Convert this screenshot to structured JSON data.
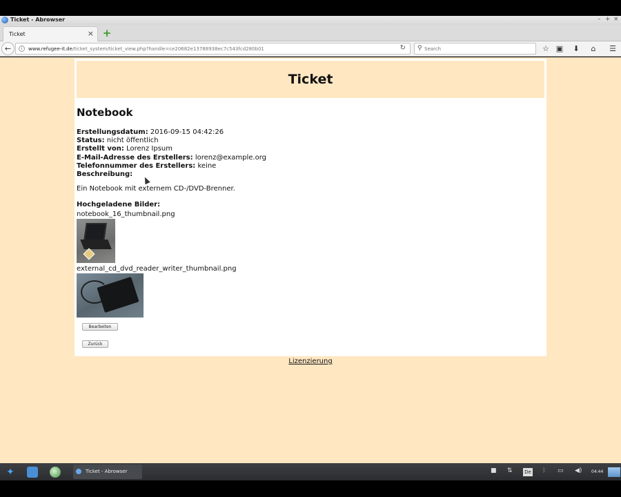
{
  "window": {
    "title": "Ticket - Abrowser",
    "controls": [
      "–",
      "+",
      "×"
    ]
  },
  "tabs": [
    {
      "label": "Ticket",
      "close": "×"
    }
  ],
  "toolbar": {
    "back": "←",
    "url_host": "www.refugee-it.de",
    "url_path": "/ticket_system/ticket_view.php?handle=ce20682e13788938ec7c543fcd280b01",
    "reload": "↻",
    "search_placeholder": "Search",
    "icons": [
      "star-icon",
      "clipboard-icon",
      "download-icon",
      "home-icon",
      "menu-icon"
    ]
  },
  "page": {
    "header": "Ticket",
    "ticket_title": "Notebook",
    "fields": [
      {
        "label": "Erstellungsdatum:",
        "value": "2016-09-15 04:42:26"
      },
      {
        "label": "Status:",
        "value": "nicht öffentlich"
      },
      {
        "label": "Erstellt von:",
        "value": "Lorenz Ipsum"
      },
      {
        "label": "E-Mail-Adresse des Erstellers:",
        "value": "lorenz@example.org"
      },
      {
        "label": "Telefonnummer des Erstellers:",
        "value": "keine"
      },
      {
        "label": "Beschreibung:",
        "value": ""
      }
    ],
    "description": "Ein Notebook mit externem CD-/DVD-Brenner.",
    "images_label": "Hochgeladene Bilder:",
    "images": [
      {
        "filename": "notebook_16_thumbnail.png"
      },
      {
        "filename": "external_cd_dvd_reader_writer_thumbnail.png"
      }
    ],
    "edit_button": "Bearbeiten",
    "back_button": "Zurück",
    "footer_link": "Lizenzierung"
  },
  "taskbar": {
    "active_task": "Ticket - Abrowser",
    "keyboard_layout": "De",
    "clock": "04:44"
  },
  "colors": {
    "page_background": "#ffe7c2",
    "card_background": "#ffffff"
  }
}
